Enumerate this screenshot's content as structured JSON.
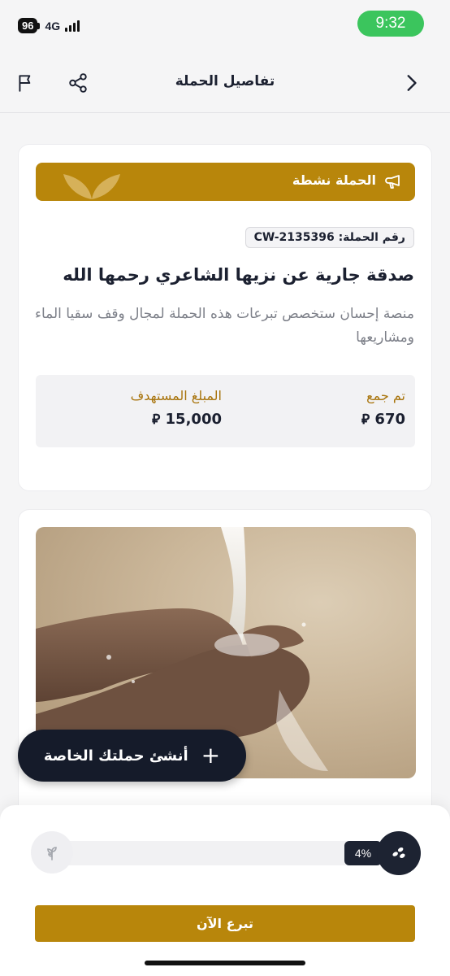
{
  "status_bar": {
    "battery": "96",
    "network": "4G",
    "time": "9:32"
  },
  "header": {
    "title": "تفاصيل الحملة",
    "icons": {
      "back": "chevron-right-icon",
      "share": "share-icon",
      "report": "flag-icon"
    }
  },
  "campaign": {
    "status_label": "الحملة نشطة",
    "id_badge": "رقم الحملة: CW-2135396",
    "title": "صدقة جارية عن نزيها الشاعري رحمها الله",
    "description": "منصة إحسان ستخصص تبرعات هذه الحملة لمجال وقف سقيا الماء ومشاريعها",
    "stats": {
      "collected_label": "تم جمع",
      "collected_value": "670",
      "target_label": "المبلغ المستهدف",
      "target_value": "15,000",
      "currency_icon": "riyal-icon"
    }
  },
  "image": {
    "subject": "water-hands-photo"
  },
  "create_button": {
    "label": "أنشئ حملتك الخاصة",
    "icon": "plus-icon"
  },
  "progress": {
    "percent_label": "4%",
    "fraction": 0.04
  },
  "donate_button": {
    "label": "تبرع الآن"
  },
  "colors": {
    "accent": "#b8860b",
    "dark": "#151b2a",
    "status_green": "#3bc55d"
  }
}
